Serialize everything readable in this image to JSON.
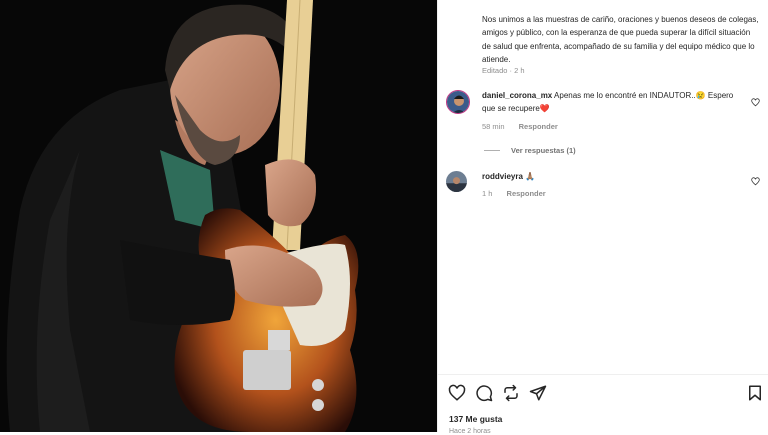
{
  "post": {
    "caption": "Nos unimos a las muestras de cariño, oraciones y buenos deseos de colegas, amigos y público, con la esperanza de que pueda superar la difícil situación de salud que enfrenta, acompañado de su familia y del equipo médico que lo atiende.",
    "edited": "Editado · 2 h",
    "photo_alt": "guitarist-with-telecaster-photo"
  },
  "comments": [
    {
      "username": "daniel_corona_mx",
      "text": "Apenas me lo encontré en INDAUTOR..😢 Espero que se recupere❤️",
      "time": "58 min",
      "reply_label": "Responder",
      "avatar_icon": "avatar-photo"
    },
    {
      "username": "roddvieyra",
      "text": "🙏🏽",
      "time": "1 h",
      "reply_label": "Responder",
      "avatar_icon": "avatar-photo"
    }
  ],
  "view_replies": "Ver respuestas (1)",
  "footer": {
    "likes": "137 Me gusta",
    "timestamp": "Hace 2 horas"
  },
  "icons": {
    "like": "heart-icon",
    "comment": "comment-icon",
    "repost": "repost-icon",
    "share": "send-icon",
    "save": "bookmark-icon"
  },
  "colors": {
    "text": "#262626",
    "muted": "#8e8e8e",
    "photo_bg": "#080808"
  }
}
